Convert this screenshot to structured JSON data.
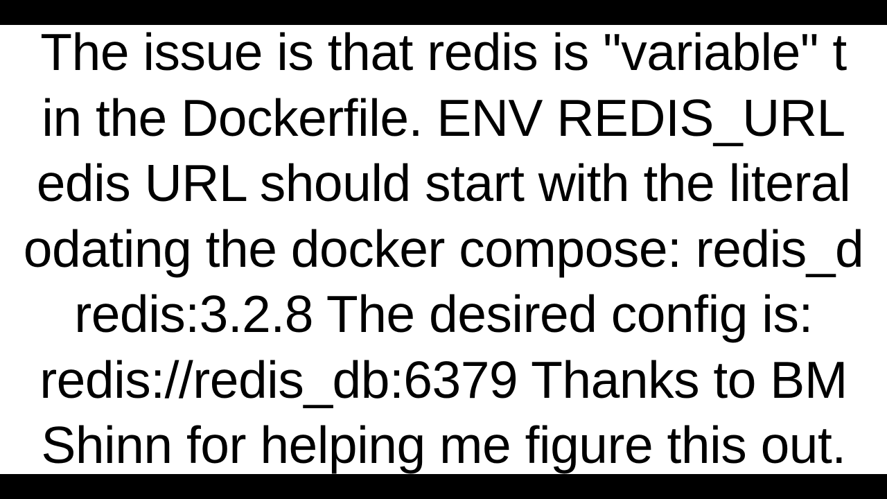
{
  "lines": {
    "l1": "The issue is that redis is \"variable\" t",
    "l2": "in the Dockerfile. ENV REDIS_URL",
    "l3": "edis URL should start with the literal",
    "l4": "odating the docker compose: redis_d",
    "l5": "redis:3.2.8  The desired config is:",
    "l6": "redis://redis_db:6379  Thanks to BM",
    "l7": "Shinn for helping me figure this out."
  }
}
